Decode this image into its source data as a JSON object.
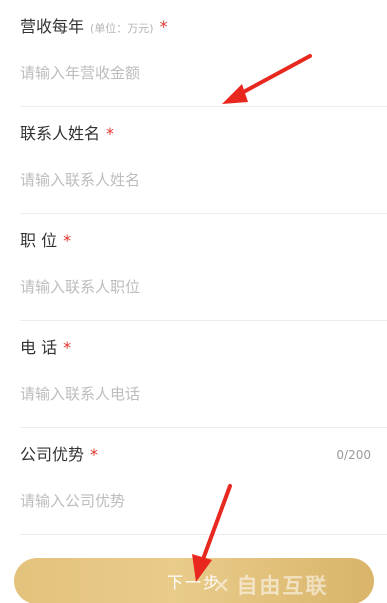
{
  "form": {
    "fields": [
      {
        "label": "营收每年",
        "unit": "(单位：万元)",
        "required_mark": "*",
        "placeholder": "请输入年营收金额",
        "value": ""
      },
      {
        "label": "联系人姓名",
        "required_mark": "*",
        "placeholder": "请输入联系人姓名",
        "value": ""
      },
      {
        "label": "职 位",
        "required_mark": "*",
        "placeholder": "请输入联系人职位",
        "value": ""
      },
      {
        "label": "电 话",
        "required_mark": "*",
        "placeholder": "请输入联系人电话",
        "value": ""
      },
      {
        "label": "公司优势",
        "required_mark": "*",
        "placeholder": "请输入公司优势",
        "value": "",
        "counter": "0/200"
      }
    ]
  },
  "next_button": {
    "label": "下一步"
  },
  "watermark": {
    "text": "自由互联"
  },
  "colors": {
    "required": "#e0342c",
    "button_gradient_start": "#e3c27c",
    "button_gradient_end": "#d9b46a",
    "arrow": "#e8281e",
    "placeholder": "#bdbdbd"
  }
}
